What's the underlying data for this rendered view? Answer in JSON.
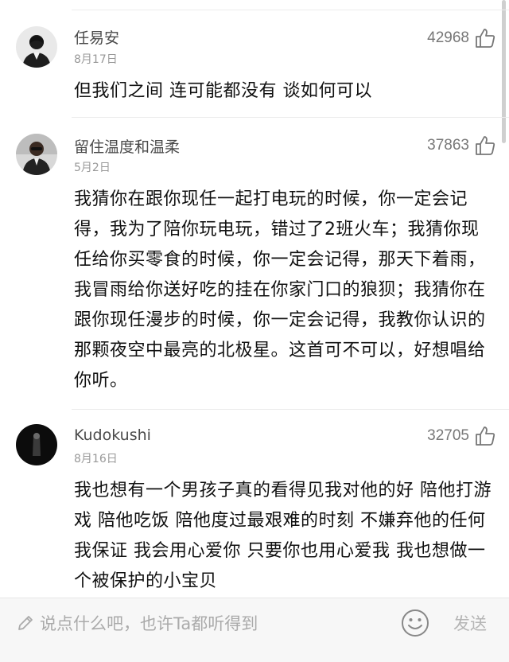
{
  "comments": [
    {
      "username": "任易安",
      "date": "8月17日",
      "likes": "42968",
      "text": "但我们之间 连可能都没有 谈如何可以"
    },
    {
      "username": "留住温度和温柔",
      "date": "5月2日",
      "likes": "37863",
      "text": "我猜你在跟你现任一起打电玩的时候，你一定会记得，我为了陪你玩电玩，错过了2班火车；我猜你现任给你买零食的时候，你一定会记得，那天下着雨，我冒雨给你送好吃的挂在你家门口的狼狈；我猜你在跟你现任漫步的时候，你一定会记得，我教你认识的那颗夜空中最亮的北极星。这首可不可以，好想唱给你听。"
    },
    {
      "username": "Kudokushi",
      "date": "8月16日",
      "likes": "32705",
      "text": "我也想有一个男孩子真的看得见我对他的好 陪他打游戏 陪他吃饭 陪他度过最艰难的时刻 不嫌弃他的任何 我保证 我会用心爱你 只要你也用心爱我 我也想做一个被保护的小宝贝"
    }
  ],
  "input_bar": {
    "placeholder": "说点什么吧，也许Ta都听得到",
    "send_label": "发送",
    "pencil_icon": "pencil-icon",
    "emoji_icon": "smiley-face-icon"
  },
  "colors": {
    "background": "#ffffff",
    "text": "#111111",
    "meta": "#999999",
    "like": "#777777",
    "input_bar": "#f7f7f7"
  }
}
